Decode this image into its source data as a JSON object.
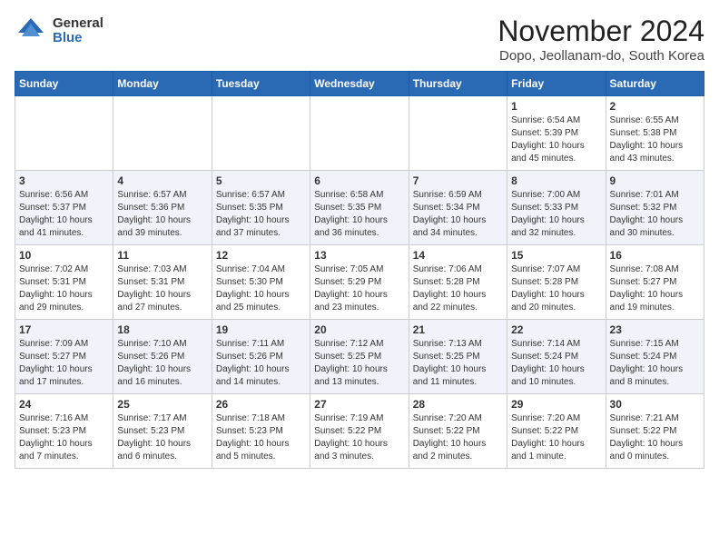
{
  "header": {
    "logo_general": "General",
    "logo_blue": "Blue",
    "month_title": "November 2024",
    "location": "Dopo, Jeollanam-do, South Korea"
  },
  "weekdays": [
    "Sunday",
    "Monday",
    "Tuesday",
    "Wednesday",
    "Thursday",
    "Friday",
    "Saturday"
  ],
  "weeks": [
    [
      {
        "day": "",
        "info": ""
      },
      {
        "day": "",
        "info": ""
      },
      {
        "day": "",
        "info": ""
      },
      {
        "day": "",
        "info": ""
      },
      {
        "day": "",
        "info": ""
      },
      {
        "day": "1",
        "info": "Sunrise: 6:54 AM\nSunset: 5:39 PM\nDaylight: 10 hours and 45 minutes."
      },
      {
        "day": "2",
        "info": "Sunrise: 6:55 AM\nSunset: 5:38 PM\nDaylight: 10 hours and 43 minutes."
      }
    ],
    [
      {
        "day": "3",
        "info": "Sunrise: 6:56 AM\nSunset: 5:37 PM\nDaylight: 10 hours and 41 minutes."
      },
      {
        "day": "4",
        "info": "Sunrise: 6:57 AM\nSunset: 5:36 PM\nDaylight: 10 hours and 39 minutes."
      },
      {
        "day": "5",
        "info": "Sunrise: 6:57 AM\nSunset: 5:35 PM\nDaylight: 10 hours and 37 minutes."
      },
      {
        "day": "6",
        "info": "Sunrise: 6:58 AM\nSunset: 5:35 PM\nDaylight: 10 hours and 36 minutes."
      },
      {
        "day": "7",
        "info": "Sunrise: 6:59 AM\nSunset: 5:34 PM\nDaylight: 10 hours and 34 minutes."
      },
      {
        "day": "8",
        "info": "Sunrise: 7:00 AM\nSunset: 5:33 PM\nDaylight: 10 hours and 32 minutes."
      },
      {
        "day": "9",
        "info": "Sunrise: 7:01 AM\nSunset: 5:32 PM\nDaylight: 10 hours and 30 minutes."
      }
    ],
    [
      {
        "day": "10",
        "info": "Sunrise: 7:02 AM\nSunset: 5:31 PM\nDaylight: 10 hours and 29 minutes."
      },
      {
        "day": "11",
        "info": "Sunrise: 7:03 AM\nSunset: 5:31 PM\nDaylight: 10 hours and 27 minutes."
      },
      {
        "day": "12",
        "info": "Sunrise: 7:04 AM\nSunset: 5:30 PM\nDaylight: 10 hours and 25 minutes."
      },
      {
        "day": "13",
        "info": "Sunrise: 7:05 AM\nSunset: 5:29 PM\nDaylight: 10 hours and 23 minutes."
      },
      {
        "day": "14",
        "info": "Sunrise: 7:06 AM\nSunset: 5:28 PM\nDaylight: 10 hours and 22 minutes."
      },
      {
        "day": "15",
        "info": "Sunrise: 7:07 AM\nSunset: 5:28 PM\nDaylight: 10 hours and 20 minutes."
      },
      {
        "day": "16",
        "info": "Sunrise: 7:08 AM\nSunset: 5:27 PM\nDaylight: 10 hours and 19 minutes."
      }
    ],
    [
      {
        "day": "17",
        "info": "Sunrise: 7:09 AM\nSunset: 5:27 PM\nDaylight: 10 hours and 17 minutes."
      },
      {
        "day": "18",
        "info": "Sunrise: 7:10 AM\nSunset: 5:26 PM\nDaylight: 10 hours and 16 minutes."
      },
      {
        "day": "19",
        "info": "Sunrise: 7:11 AM\nSunset: 5:26 PM\nDaylight: 10 hours and 14 minutes."
      },
      {
        "day": "20",
        "info": "Sunrise: 7:12 AM\nSunset: 5:25 PM\nDaylight: 10 hours and 13 minutes."
      },
      {
        "day": "21",
        "info": "Sunrise: 7:13 AM\nSunset: 5:25 PM\nDaylight: 10 hours and 11 minutes."
      },
      {
        "day": "22",
        "info": "Sunrise: 7:14 AM\nSunset: 5:24 PM\nDaylight: 10 hours and 10 minutes."
      },
      {
        "day": "23",
        "info": "Sunrise: 7:15 AM\nSunset: 5:24 PM\nDaylight: 10 hours and 8 minutes."
      }
    ],
    [
      {
        "day": "24",
        "info": "Sunrise: 7:16 AM\nSunset: 5:23 PM\nDaylight: 10 hours and 7 minutes."
      },
      {
        "day": "25",
        "info": "Sunrise: 7:17 AM\nSunset: 5:23 PM\nDaylight: 10 hours and 6 minutes."
      },
      {
        "day": "26",
        "info": "Sunrise: 7:18 AM\nSunset: 5:23 PM\nDaylight: 10 hours and 5 minutes."
      },
      {
        "day": "27",
        "info": "Sunrise: 7:19 AM\nSunset: 5:22 PM\nDaylight: 10 hours and 3 minutes."
      },
      {
        "day": "28",
        "info": "Sunrise: 7:20 AM\nSunset: 5:22 PM\nDaylight: 10 hours and 2 minutes."
      },
      {
        "day": "29",
        "info": "Sunrise: 7:20 AM\nSunset: 5:22 PM\nDaylight: 10 hours and 1 minute."
      },
      {
        "day": "30",
        "info": "Sunrise: 7:21 AM\nSunset: 5:22 PM\nDaylight: 10 hours and 0 minutes."
      }
    ]
  ]
}
